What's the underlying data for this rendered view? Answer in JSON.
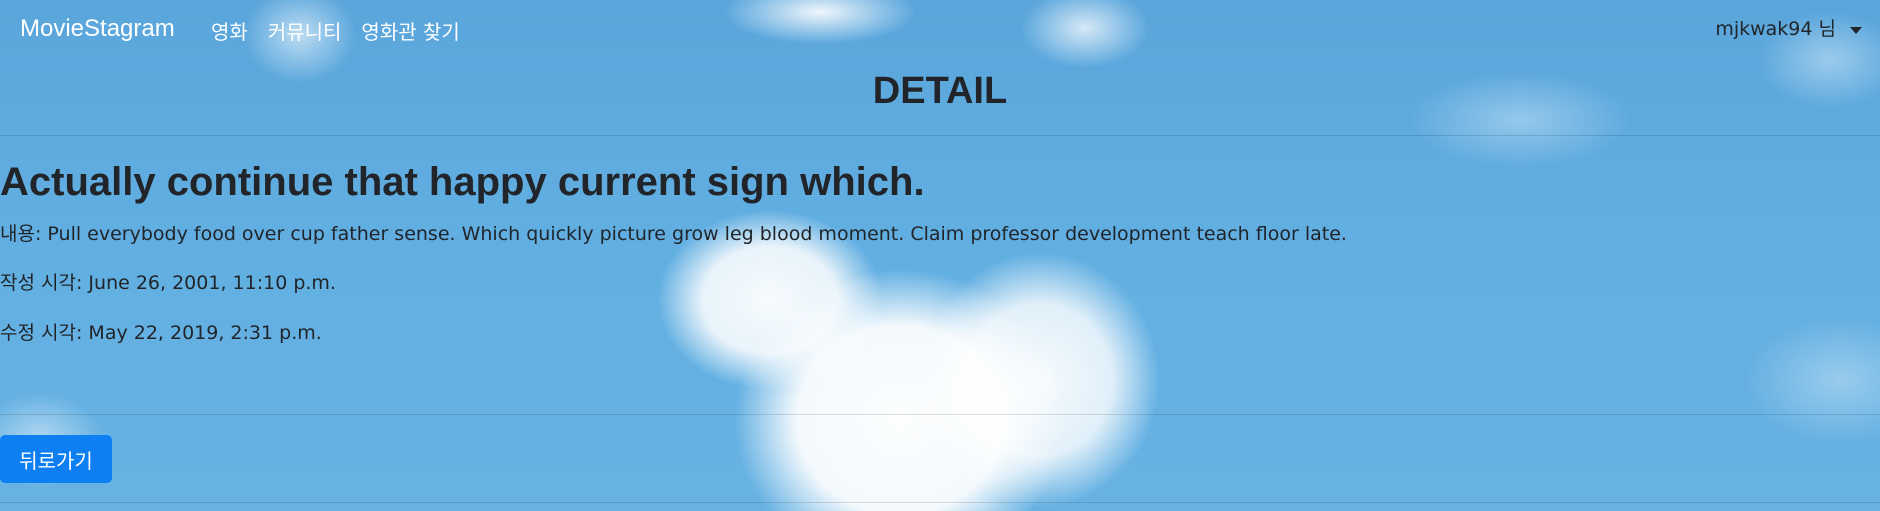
{
  "navbar": {
    "brand": "MovieStagram",
    "links": [
      "영화",
      "커뮤니티",
      "영화관 찾기"
    ],
    "user_label": "mjkwak94 님",
    "user_menu_icon": "caret-down-icon"
  },
  "page": {
    "title": "DETAIL"
  },
  "post": {
    "title": "Actually continue that happy current sign which.",
    "content_label": "내용",
    "content": "Pull everybody food over cup father sense. Which quickly picture grow leg blood moment. Claim professor development teach floor late.",
    "created_label": "작성 시각",
    "created_at": "June 26, 2001, 11:10 p.m.",
    "updated_label": "수정 시각",
    "updated_at": "May 22, 2019, 2:31 p.m."
  },
  "actions": {
    "back_label": "뒤로가기"
  },
  "colors": {
    "primary_button": "#0d7ff2",
    "sky_background": "#62afe2",
    "text": "#212529"
  }
}
